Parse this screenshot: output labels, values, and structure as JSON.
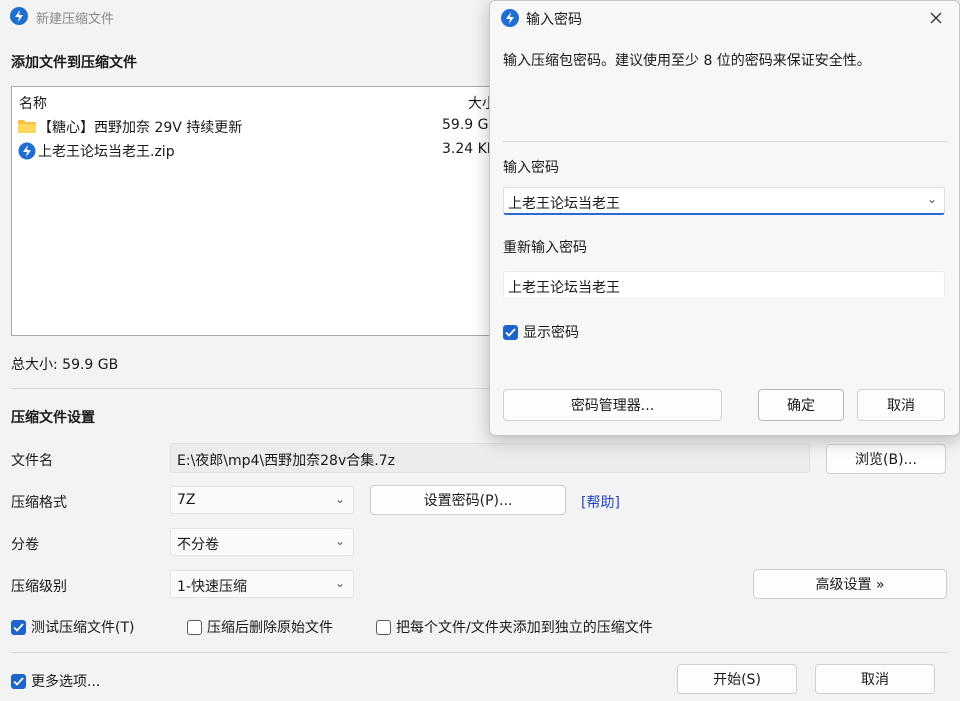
{
  "main": {
    "title": "新建压缩文件",
    "add_section_title": "添加文件到压缩文件",
    "columns": {
      "name": "名称",
      "size": "大小"
    },
    "files": [
      {
        "name": "【糖心】西野加奈 29V 持续更新",
        "size": "59.9 GB",
        "icon": "folder-icon"
      },
      {
        "name": "上老王论坛当老王.zip",
        "size": "3.24 KB",
        "icon": "zip-archive-icon"
      }
    ],
    "total_size": "总大小: 59.9 GB",
    "settings_title": "压缩文件设置",
    "filename_label": "文件名",
    "filename_value": "E:\\夜郎\\mp4\\西野加奈28v合集.7z",
    "browse_button": "浏览(B)...",
    "format_label": "压缩格式",
    "format_value": "7Z",
    "set_password_button": "设置密码(P)...",
    "help_link": "[帮助]",
    "split_label": "分卷",
    "split_value": "不分卷",
    "level_label": "压缩级别",
    "level_value": "1-快速压缩",
    "advanced_button": "高级设置 »",
    "options": [
      {
        "label": "测试压缩文件(T)",
        "checked": true
      },
      {
        "label": "压缩后删除原始文件",
        "checked": false
      },
      {
        "label": "把每个文件/文件夹添加到独立的压缩文件",
        "checked": false
      }
    ],
    "more_options": {
      "label": "更多选项...",
      "checked": true
    },
    "start_button": "开始(S)",
    "cancel_button": "取消"
  },
  "dialog": {
    "title": "输入密码",
    "description": "输入压缩包密码。建议使用至少 8 位的密码来保证安全性。",
    "password_label": "输入密码",
    "password_value": "上老王论坛当老王",
    "reenter_label": "重新输入密码",
    "reenter_value": "上老王论坛当老王",
    "show_password": {
      "label": "显示密码",
      "checked": true
    },
    "manager_button": "密码管理器...",
    "ok_button": "确定",
    "cancel_button": "取消"
  },
  "colors": {
    "accent": "#1f64c8",
    "link": "#2442c8",
    "background": "#f3f3f3"
  }
}
